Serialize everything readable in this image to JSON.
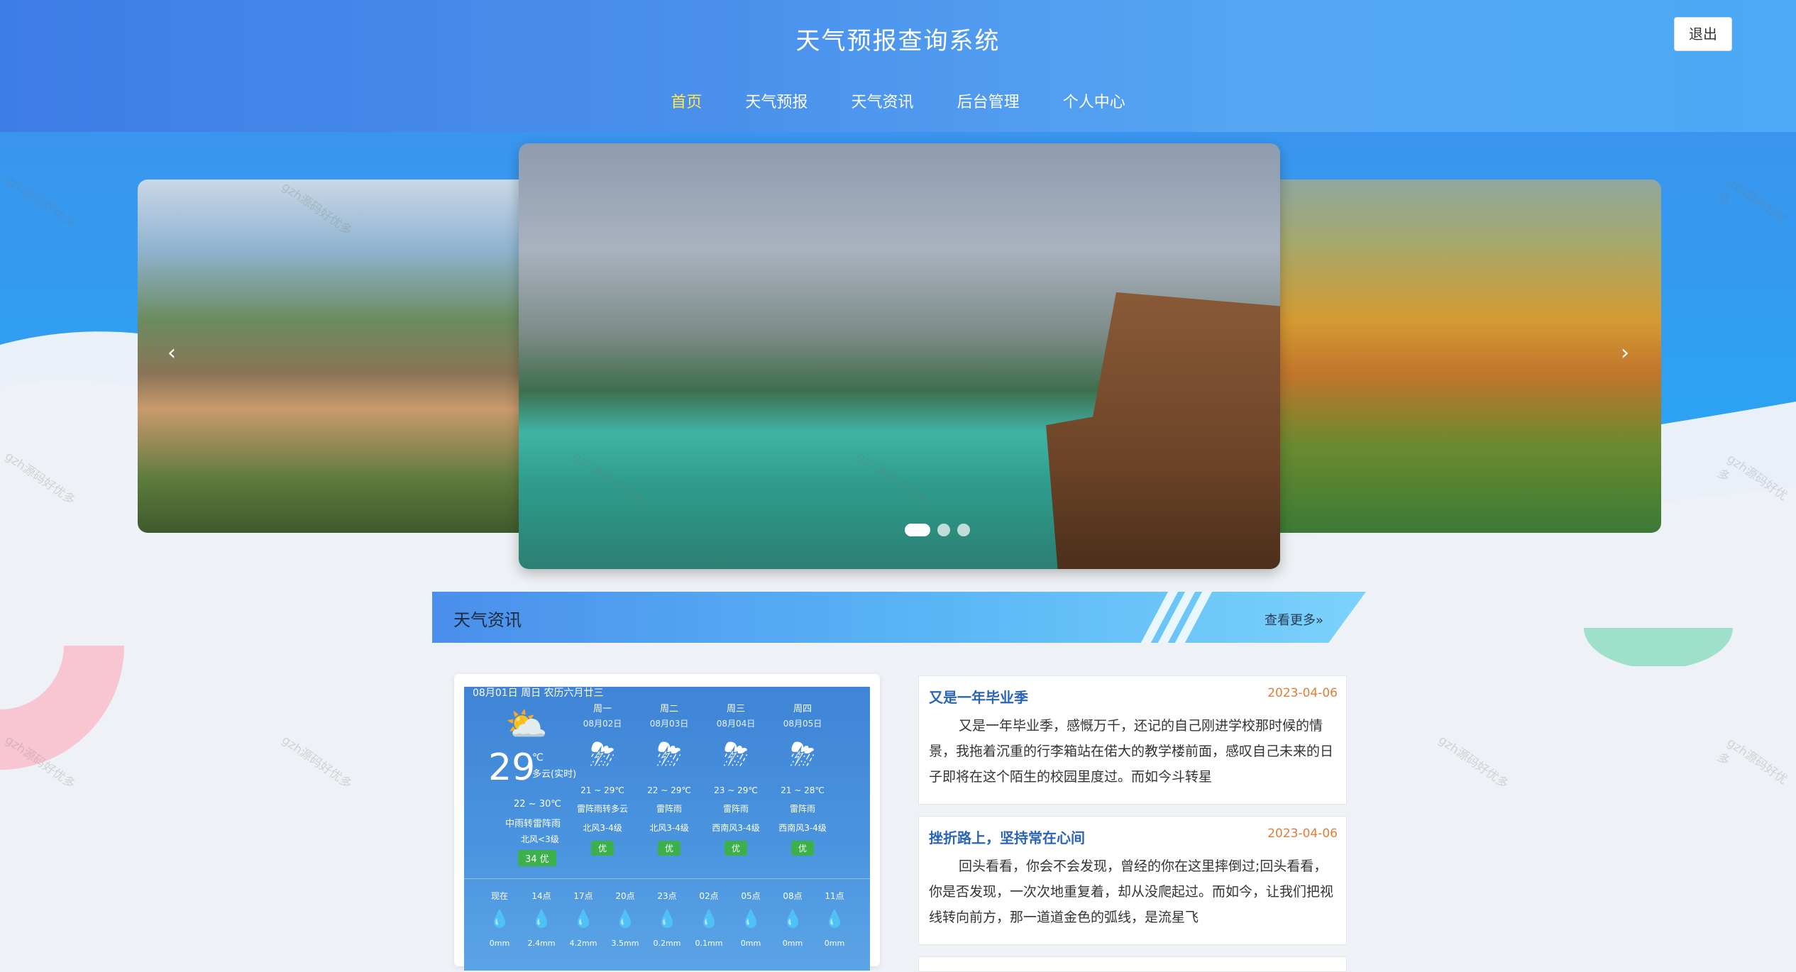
{
  "header": {
    "title": "天气预报查询系统",
    "logout_label": "退出"
  },
  "nav": {
    "items": [
      "首页",
      "天气预报",
      "天气资讯",
      "后台管理",
      "个人中心"
    ],
    "active_index": 0
  },
  "carousel": {
    "prev_label": "‹",
    "next_label": "›",
    "dot_count": 3,
    "active_dot": 0
  },
  "section": {
    "title": "天气资讯",
    "more_label": "查看更多»"
  },
  "weather": {
    "date_line": "08月01日 周日 农历六月廿三",
    "current_temp": "29",
    "unit": "℃",
    "current_desc": "多云(实时)",
    "range": "22 ~ 30℃",
    "condition": "中雨转雷阵雨",
    "wind": "北风<3级",
    "aqi": "34 优",
    "days": [
      {
        "name": "周一",
        "date": "08月02日",
        "range": "21 ~ 29℃",
        "cond": "雷阵雨转多云",
        "wind": "北风3-4级",
        "aqi": "优"
      },
      {
        "name": "周二",
        "date": "08月03日",
        "range": "22 ~ 29℃",
        "cond": "雷阵雨",
        "wind": "北风3-4级",
        "aqi": "优"
      },
      {
        "name": "周三",
        "date": "08月04日",
        "range": "23 ~ 29℃",
        "cond": "雷阵雨",
        "wind": "西南风3-4级",
        "aqi": "优"
      },
      {
        "name": "周四",
        "date": "08月05日",
        "range": "21 ~ 28℃",
        "cond": "雷阵雨",
        "wind": "西南风3-4级",
        "aqi": "优"
      }
    ],
    "hours": [
      {
        "time": "现在",
        "value": "0mm"
      },
      {
        "time": "14点",
        "value": "2.4mm"
      },
      {
        "time": "17点",
        "value": "4.2mm"
      },
      {
        "time": "20点",
        "value": "3.5mm"
      },
      {
        "time": "23点",
        "value": "0.2mm"
      },
      {
        "time": "02点",
        "value": "0.1mm"
      },
      {
        "time": "05点",
        "value": "0mm"
      },
      {
        "time": "08点",
        "value": "0mm"
      },
      {
        "time": "11点",
        "value": "0mm"
      }
    ]
  },
  "news": [
    {
      "title": "又是一年毕业季",
      "date": "2023-04-06",
      "body": "又是一年毕业季，感慨万千，还记的自己刚进学校那时候的情景，我拖着沉重的行李箱站在偌大的教学楼前面，感叹自己未来的日子即将在这个陌生的校园里度过。而如今斗转星"
    },
    {
      "title": "挫折路上，坚持常在心间",
      "date": "2023-04-06",
      "body": "回头看看，你会不会发现，曾经的你在这里摔倒过;回头看看，你是否发现，一次次地重复着，却从没爬起过。而如今，让我们把视线转向前方，那一道道金色的弧线，是流星飞"
    }
  ],
  "watermark": "gzh源码好优多",
  "colors": {
    "header_blue": "#4a90ec",
    "nav_active": "#ffe84a",
    "news_title": "#2a64b8",
    "news_date": "#e07d3a",
    "aqi_green": "#3cb04a"
  }
}
